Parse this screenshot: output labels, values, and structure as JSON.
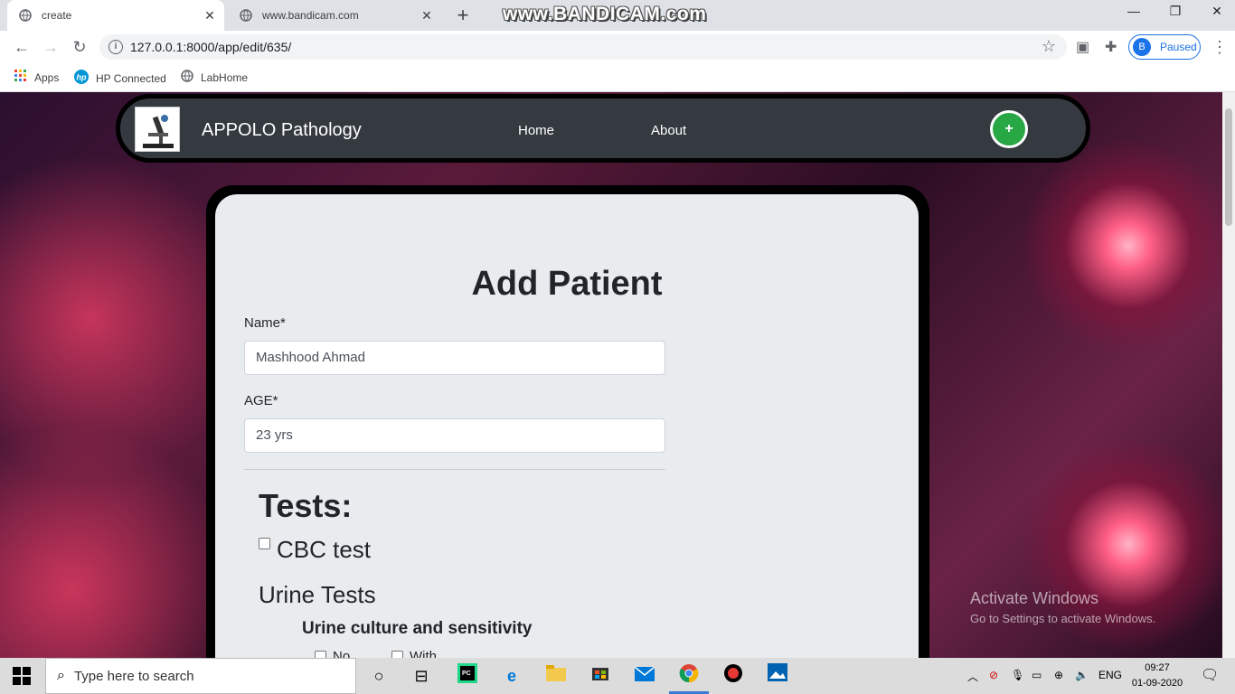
{
  "browser": {
    "tabs": [
      {
        "title": "create",
        "icon": "globe-icon"
      },
      {
        "title": "www.bandicam.com",
        "icon": "globe-icon"
      }
    ],
    "watermark": "www.BANDICAM.com",
    "url": "127.0.0.1:8000/app/edit/635/",
    "profile_initial": "B",
    "profile_status": "Paused",
    "bookmarks": [
      {
        "label": "Apps",
        "icon": "apps-grid-icon"
      },
      {
        "label": "HP Connected",
        "icon": "hp-logo-icon"
      },
      {
        "label": "LabHome",
        "icon": "globe-icon"
      }
    ]
  },
  "navbar": {
    "brand": "APPOLO Pathology",
    "links": [
      "Home",
      "About"
    ],
    "add_label": "+"
  },
  "form": {
    "title": "Add Patient",
    "name_label": "Name*",
    "name_value": "Mashhood Ahmad",
    "age_label": "AGE*",
    "age_value": "23 yrs",
    "tests_heading": "Tests:",
    "cbc_label": "CBC test",
    "urine_heading": "Urine Tests",
    "culture_heading": "Urine culture and sensitivity",
    "culture_options": [
      "No",
      "With"
    ]
  },
  "activation": {
    "title": "Activate Windows",
    "subtitle": "Go to Settings to activate Windows."
  },
  "taskbar": {
    "search_placeholder": "Type here to search",
    "language": "ENG",
    "time": "09:27",
    "date": "01-09-2020"
  }
}
